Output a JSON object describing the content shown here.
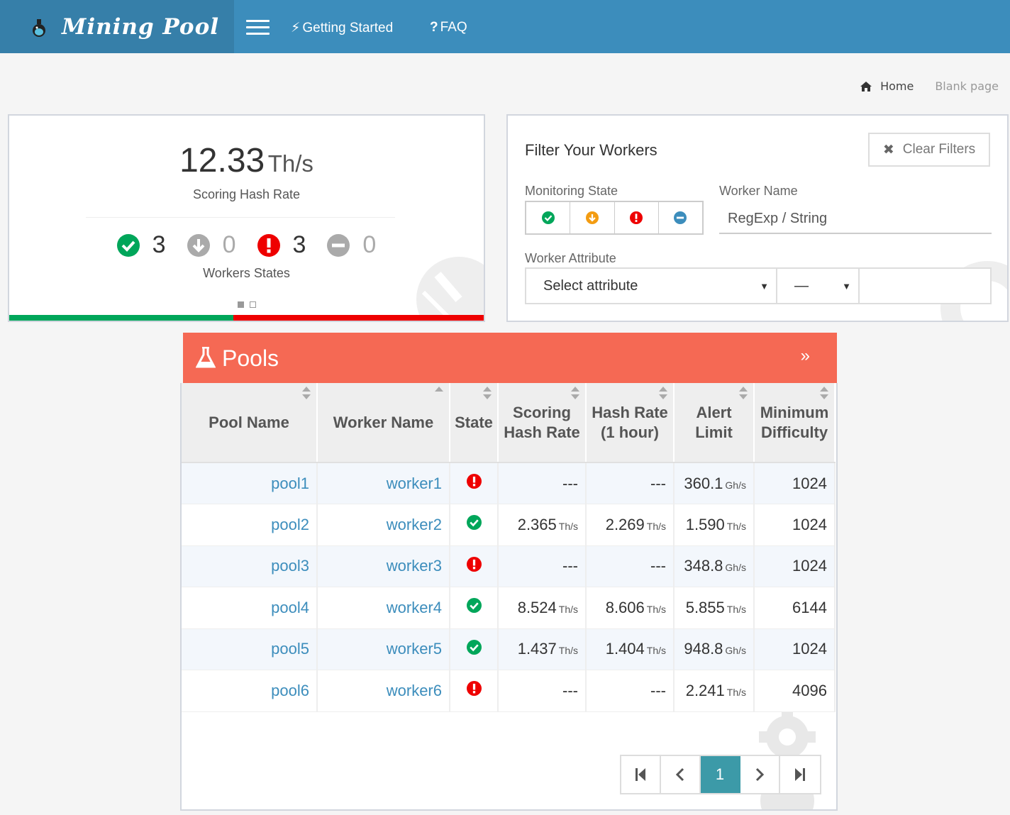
{
  "app": {
    "title": "Mining Pool",
    "nav": [
      {
        "icon": "bolt-icon",
        "glyph": "⚡",
        "label": "Getting Started"
      },
      {
        "icon": "question-icon",
        "glyph": "?",
        "label": "FAQ"
      }
    ]
  },
  "breadcrumb": {
    "home": "Home",
    "current": "Blank page"
  },
  "stats": {
    "rate_value": "12.33",
    "rate_unit": "Th/s",
    "rate_label": "Scoring Hash Rate",
    "states": [
      {
        "name": "ok",
        "icon": "check-circle-icon",
        "count": "3",
        "color": "#00a65a"
      },
      {
        "name": "down",
        "icon": "arrow-down-circle-icon",
        "count": "0",
        "color": "#aaaaaa"
      },
      {
        "name": "alert",
        "icon": "exclamation-circle-icon",
        "count": "3",
        "color": "#ee0000"
      },
      {
        "name": "disabled",
        "icon": "minus-circle-icon",
        "count": "0",
        "color": "#aaaaaa"
      }
    ],
    "states_label": "Workers States",
    "ok_fraction": 0.473
  },
  "filter": {
    "title": "Filter Your Workers",
    "clear_label": "Clear Filters",
    "monitoring_label": "Monitoring State",
    "monitoring_options": [
      {
        "icon": "check-circle-icon",
        "color": "#00a65a"
      },
      {
        "icon": "arrow-down-circle-icon",
        "color": "#f39c12"
      },
      {
        "icon": "exclamation-circle-icon",
        "color": "#ee0000"
      },
      {
        "icon": "minus-circle-icon",
        "color": "#3c8dbc"
      }
    ],
    "worker_name_label": "Worker Name",
    "worker_name_placeholder": "RegExp / String",
    "attribute_label": "Worker Attribute",
    "attribute_select": "Select attribute",
    "operator_select": "—"
  },
  "pools": {
    "title": "Pools",
    "columns": [
      "Pool Name",
      "Worker Name",
      "State",
      "Scoring Hash Rate",
      "Hash Rate (1 hour)",
      "Alert Limit",
      "Minimum Difficulty"
    ],
    "rows": [
      {
        "pool": "pool1",
        "worker": "worker1",
        "state": "alert",
        "scoring": "---",
        "scoring_unit": "",
        "hash": "---",
        "hash_unit": "",
        "alert": "360.1",
        "alert_unit": "Gh/s",
        "difficulty": "1024"
      },
      {
        "pool": "pool2",
        "worker": "worker2",
        "state": "ok",
        "scoring": "2.365",
        "scoring_unit": "Th/s",
        "hash": "2.269",
        "hash_unit": "Th/s",
        "alert": "1.590",
        "alert_unit": "Th/s",
        "difficulty": "1024"
      },
      {
        "pool": "pool3",
        "worker": "worker3",
        "state": "alert",
        "scoring": "---",
        "scoring_unit": "",
        "hash": "---",
        "hash_unit": "",
        "alert": "348.8",
        "alert_unit": "Gh/s",
        "difficulty": "1024"
      },
      {
        "pool": "pool4",
        "worker": "worker4",
        "state": "ok",
        "scoring": "8.524",
        "scoring_unit": "Th/s",
        "hash": "8.606",
        "hash_unit": "Th/s",
        "alert": "5.855",
        "alert_unit": "Th/s",
        "difficulty": "6144"
      },
      {
        "pool": "pool5",
        "worker": "worker5",
        "state": "ok",
        "scoring": "1.437",
        "scoring_unit": "Th/s",
        "hash": "1.404",
        "hash_unit": "Th/s",
        "alert": "948.8",
        "alert_unit": "Gh/s",
        "difficulty": "1024"
      },
      {
        "pool": "pool6",
        "worker": "worker6",
        "state": "alert",
        "scoring": "---",
        "scoring_unit": "",
        "hash": "---",
        "hash_unit": "",
        "alert": "2.241",
        "alert_unit": "Th/s",
        "difficulty": "4096"
      }
    ],
    "pagination": {
      "current_page": "1"
    }
  }
}
